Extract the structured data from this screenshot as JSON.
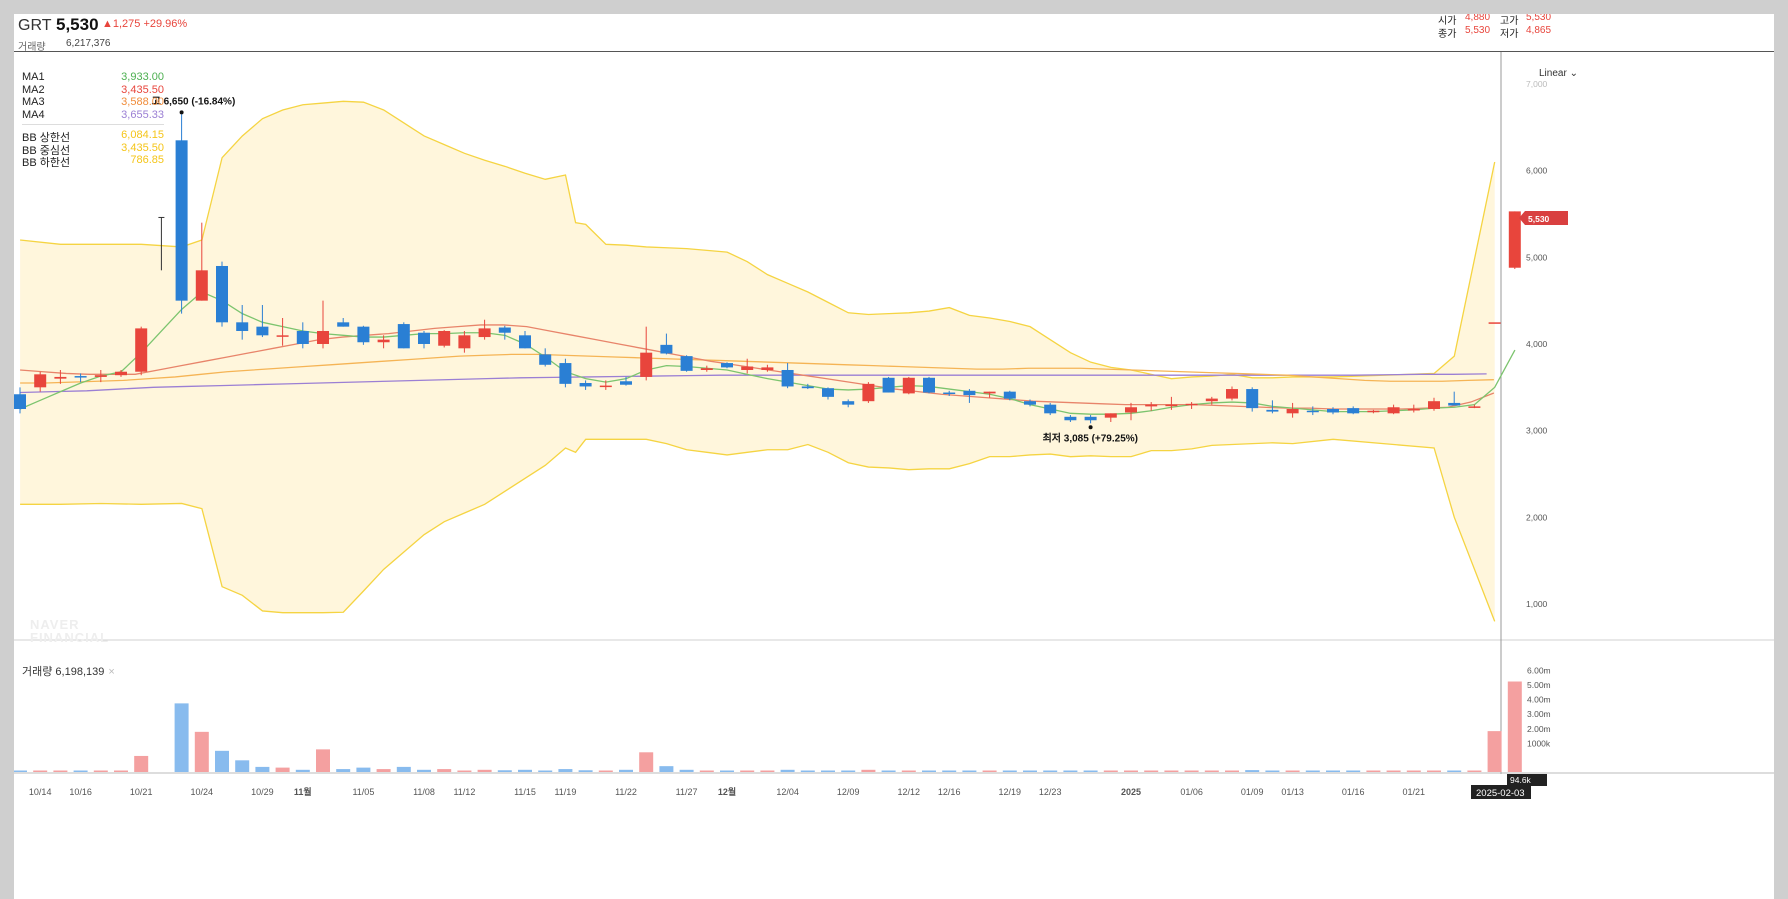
{
  "header": {
    "symbol": "GRT",
    "price": "5,530",
    "change": "▲1,275 +29.96%",
    "volume_label": "거래량",
    "volume_value": "6,217,376",
    "open_label": "시가",
    "open_value": "4,880",
    "high_label": "고가",
    "high_value": "5,530",
    "close_label": "종가",
    "close_value": "5,530",
    "low_label": "저가",
    "low_value": "4,865"
  },
  "legend": [
    {
      "name": "MA1",
      "value": "3,933.00",
      "color": "#4caf50"
    },
    {
      "name": "MA2",
      "value": "3,435.50",
      "color": "#e8453c"
    },
    {
      "name": "MA3",
      "value": "3,588.00",
      "color": "#f08c3a"
    },
    {
      "name": "MA4",
      "value": "3,655.33",
      "color": "#9b7fd4"
    },
    {
      "name": "BB 상한선",
      "value": "6,084.15",
      "color": "#f5c518"
    },
    {
      "name": "BB 중심선",
      "value": "3,435.50",
      "color": "#f5c518"
    },
    {
      "name": "BB 하한선",
      "value": "786.85",
      "color": "#f5c518"
    }
  ],
  "scale_mode": "Linear",
  "watermark": [
    "NAVER",
    "FINANCIAL"
  ],
  "volume_title": "거래량 6,198,139",
  "volume_close_glyph": "×",
  "price_tag": "5,530",
  "volume_tag": "94.6k",
  "date_tag": "2025-02-03",
  "high_annotation": "고 6,650 (-16.84%)",
  "low_annotation": "최저 3,085 (+79.25%)",
  "colors": {
    "up": "#e8453c",
    "down": "#2a7fd4",
    "up_vol": "#f4a0a0",
    "down_vol": "#88bbee",
    "band_fill": "#fff6dc",
    "band_line": "#f5d442"
  },
  "chart_data": {
    "type": "candlestick",
    "price_axis": {
      "min": 0,
      "max": 7000,
      "ticks": [
        "1,000",
        "2,000",
        "3,000",
        "4,000",
        "5,000",
        "6,000",
        "7,000"
      ],
      "tick_values": [
        1000,
        2000,
        3000,
        4000,
        5000,
        6000,
        7000
      ]
    },
    "volume_axis": {
      "min": 0,
      "max": 7000000,
      "ticks": [
        "1000k",
        "2.00m",
        "3.00m",
        "4.00m",
        "5.00m",
        "6.00m"
      ],
      "tick_values": [
        1000000,
        2000000,
        3000000,
        4000000,
        5000000,
        6000000
      ]
    },
    "x_ticks": [
      {
        "label": "10/14",
        "i": 1
      },
      {
        "label": "10/16",
        "i": 3
      },
      {
        "label": "10/21",
        "i": 6
      },
      {
        "label": "10/24",
        "i": 9
      },
      {
        "label": "10/29",
        "i": 12
      },
      {
        "label": "11월",
        "i": 14,
        "bold": true
      },
      {
        "label": "11/05",
        "i": 17
      },
      {
        "label": "11/08",
        "i": 20
      },
      {
        "label": "11/12",
        "i": 22
      },
      {
        "label": "11/15",
        "i": 25
      },
      {
        "label": "11/19",
        "i": 27
      },
      {
        "label": "11/22",
        "i": 30
      },
      {
        "label": "11/27",
        "i": 33
      },
      {
        "label": "12월",
        "i": 35,
        "bold": true
      },
      {
        "label": "12/04",
        "i": 38
      },
      {
        "label": "12/09",
        "i": 41
      },
      {
        "label": "12/12",
        "i": 44
      },
      {
        "label": "12/16",
        "i": 46
      },
      {
        "label": "12/19",
        "i": 49
      },
      {
        "label": "12/23",
        "i": 51
      },
      {
        "label": "2025",
        "i": 55,
        "bold": true
      },
      {
        "label": "01/06",
        "i": 58
      },
      {
        "label": "01/09",
        "i": 61
      },
      {
        "label": "01/13",
        "i": 63
      },
      {
        "label": "01/16",
        "i": 66
      },
      {
        "label": "01/21",
        "i": 69
      }
    ],
    "candles": [
      {
        "o": 3420,
        "h": 3500,
        "l": 3200,
        "c": 3250,
        "v": 60000
      },
      {
        "o": 3500,
        "h": 3680,
        "l": 3450,
        "c": 3650,
        "v": 40000
      },
      {
        "o": 3600,
        "h": 3700,
        "l": 3540,
        "c": 3620,
        "v": 35000
      },
      {
        "o": 3630,
        "h": 3660,
        "l": 3560,
        "c": 3620,
        "v": 30000
      },
      {
        "o": 3620,
        "h": 3700,
        "l": 3560,
        "c": 3640,
        "v": 45000
      },
      {
        "o": 3640,
        "h": 3700,
        "l": 3620,
        "c": 3680,
        "v": 50000
      },
      {
        "o": 3680,
        "h": 4200,
        "l": 3640,
        "c": 4180,
        "v": 1100000
      },
      {
        "o": 5450,
        "h": 5460,
        "l": 4850,
        "c": 5450,
        "v": 0
      },
      {
        "o": 6350,
        "h": 6650,
        "l": 4350,
        "c": 4500,
        "v": 4700000
      },
      {
        "o": 4500,
        "h": 5400,
        "l": 4500,
        "c": 4850,
        "v": 2750000
      },
      {
        "o": 4900,
        "h": 4950,
        "l": 4200,
        "c": 4250,
        "v": 1450000
      },
      {
        "o": 4250,
        "h": 4450,
        "l": 4050,
        "c": 4150,
        "v": 800000
      },
      {
        "o": 4200,
        "h": 4450,
        "l": 4080,
        "c": 4100,
        "v": 350000
      },
      {
        "o": 4100,
        "h": 4300,
        "l": 3980,
        "c": 4100,
        "v": 300000
      },
      {
        "o": 4150,
        "h": 4250,
        "l": 3950,
        "c": 4000,
        "v": 150000
      },
      {
        "o": 4000,
        "h": 4500,
        "l": 3950,
        "c": 4150,
        "v": 1550000
      },
      {
        "o": 4250,
        "h": 4300,
        "l": 4200,
        "c": 4200,
        "v": 200000
      },
      {
        "o": 4200,
        "h": 4210,
        "l": 3990,
        "c": 4020,
        "v": 300000
      },
      {
        "o": 4020,
        "h": 4100,
        "l": 3950,
        "c": 4050,
        "v": 200000
      },
      {
        "o": 4230,
        "h": 4250,
        "l": 3950,
        "c": 3950,
        "v": 350000
      },
      {
        "o": 4130,
        "h": 4150,
        "l": 3950,
        "c": 4000,
        "v": 150000
      },
      {
        "o": 3980,
        "h": 4160,
        "l": 3960,
        "c": 4150,
        "v": 200000
      },
      {
        "o": 3950,
        "h": 4150,
        "l": 3900,
        "c": 4100,
        "v": 100000
      },
      {
        "o": 4080,
        "h": 4280,
        "l": 4050,
        "c": 4180,
        "v": 150000
      },
      {
        "o": 4190,
        "h": 4210,
        "l": 4050,
        "c": 4130,
        "v": 120000
      },
      {
        "o": 4100,
        "h": 4150,
        "l": 3950,
        "c": 3950,
        "v": 150000
      },
      {
        "o": 3880,
        "h": 3950,
        "l": 3740,
        "c": 3760,
        "v": 80000
      },
      {
        "o": 3780,
        "h": 3830,
        "l": 3500,
        "c": 3540,
        "v": 200000
      },
      {
        "o": 3550,
        "h": 3580,
        "l": 3470,
        "c": 3510,
        "v": 120000
      },
      {
        "o": 3510,
        "h": 3580,
        "l": 3470,
        "c": 3520,
        "v": 100000
      },
      {
        "o": 3570,
        "h": 3620,
        "l": 3520,
        "c": 3530,
        "v": 150000
      },
      {
        "o": 3620,
        "h": 4200,
        "l": 3580,
        "c": 3900,
        "v": 1350000
      },
      {
        "o": 3990,
        "h": 4120,
        "l": 3880,
        "c": 3890,
        "v": 400000
      },
      {
        "o": 3860,
        "h": 3870,
        "l": 3680,
        "c": 3690,
        "v": 150000
      },
      {
        "o": 3700,
        "h": 3750,
        "l": 3680,
        "c": 3720,
        "v": 100000
      },
      {
        "o": 3780,
        "h": 3790,
        "l": 3720,
        "c": 3730,
        "v": 80000
      },
      {
        "o": 3700,
        "h": 3830,
        "l": 3660,
        "c": 3740,
        "v": 60000
      },
      {
        "o": 3700,
        "h": 3760,
        "l": 3680,
        "c": 3730,
        "v": 60000
      },
      {
        "o": 3700,
        "h": 3780,
        "l": 3490,
        "c": 3510,
        "v": 150000
      },
      {
        "o": 3510,
        "h": 3540,
        "l": 3480,
        "c": 3490,
        "v": 80000
      },
      {
        "o": 3490,
        "h": 3500,
        "l": 3360,
        "c": 3390,
        "v": 90000
      },
      {
        "o": 3340,
        "h": 3360,
        "l": 3270,
        "c": 3300,
        "v": 100000
      },
      {
        "o": 3340,
        "h": 3560,
        "l": 3320,
        "c": 3540,
        "v": 150000
      },
      {
        "o": 3610,
        "h": 3620,
        "l": 3440,
        "c": 3440,
        "v": 100000
      },
      {
        "o": 3430,
        "h": 3620,
        "l": 3420,
        "c": 3610,
        "v": 100000
      },
      {
        "o": 3610,
        "h": 3620,
        "l": 3430,
        "c": 3440,
        "v": 60000
      },
      {
        "o": 3440,
        "h": 3460,
        "l": 3400,
        "c": 3430,
        "v": 50000
      },
      {
        "o": 3460,
        "h": 3480,
        "l": 3320,
        "c": 3410,
        "v": 50000
      },
      {
        "o": 3430,
        "h": 3450,
        "l": 3380,
        "c": 3450,
        "v": 40000
      },
      {
        "o": 3450,
        "h": 3460,
        "l": 3350,
        "c": 3370,
        "v": 40000
      },
      {
        "o": 3340,
        "h": 3360,
        "l": 3280,
        "c": 3300,
        "v": 30000
      },
      {
        "o": 3300,
        "h": 3320,
        "l": 3180,
        "c": 3200,
        "v": 40000
      },
      {
        "o": 3160,
        "h": 3180,
        "l": 3100,
        "c": 3120,
        "v": 30000
      },
      {
        "o": 3160,
        "h": 3180,
        "l": 3085,
        "c": 3120,
        "v": 60000
      },
      {
        "o": 3150,
        "h": 3200,
        "l": 3100,
        "c": 3200,
        "v": 50000
      },
      {
        "o": 3210,
        "h": 3320,
        "l": 3120,
        "c": 3270,
        "v": 70000
      },
      {
        "o": 3280,
        "h": 3330,
        "l": 3230,
        "c": 3300,
        "v": 50000
      },
      {
        "o": 3300,
        "h": 3390,
        "l": 3240,
        "c": 3300,
        "v": 40000
      },
      {
        "o": 3300,
        "h": 3330,
        "l": 3250,
        "c": 3310,
        "v": 40000
      },
      {
        "o": 3340,
        "h": 3390,
        "l": 3300,
        "c": 3370,
        "v": 50000
      },
      {
        "o": 3370,
        "h": 3510,
        "l": 3350,
        "c": 3480,
        "v": 60000
      },
      {
        "o": 3480,
        "h": 3500,
        "l": 3220,
        "c": 3260,
        "v": 130000
      },
      {
        "o": 3240,
        "h": 3350,
        "l": 3200,
        "c": 3220,
        "v": 60000
      },
      {
        "o": 3200,
        "h": 3320,
        "l": 3150,
        "c": 3250,
        "v": 40000
      },
      {
        "o": 3230,
        "h": 3280,
        "l": 3180,
        "c": 3220,
        "v": 60000
      },
      {
        "o": 3250,
        "h": 3270,
        "l": 3190,
        "c": 3210,
        "v": 50000
      },
      {
        "o": 3260,
        "h": 3280,
        "l": 3190,
        "c": 3200,
        "v": 40000
      },
      {
        "o": 3220,
        "h": 3240,
        "l": 3200,
        "c": 3230,
        "v": 30000
      },
      {
        "o": 3200,
        "h": 3300,
        "l": 3190,
        "c": 3270,
        "v": 60000
      },
      {
        "o": 3240,
        "h": 3300,
        "l": 3210,
        "c": 3250,
        "v": 40000
      },
      {
        "o": 3250,
        "h": 3380,
        "l": 3230,
        "c": 3340,
        "v": 100000
      },
      {
        "o": 3320,
        "h": 3450,
        "l": 3290,
        "c": 3290,
        "v": 40000
      },
      {
        "o": 3280,
        "h": 3300,
        "l": 3260,
        "c": 3280,
        "v": 30000
      },
      {
        "o": 4250,
        "h": 4250,
        "l": 4250,
        "c": 4250,
        "v": 2800000
      },
      {
        "o": 4880,
        "h": 5530,
        "l": 4865,
        "c": 5530,
        "v": 6198139
      }
    ],
    "bb_upper": [
      5200,
      5150,
      5150,
      5150,
      5120,
      5200,
      6150,
      6400,
      6600,
      6700,
      6760,
      6780,
      6800,
      6790,
      6700,
      6550,
      6400,
      6300,
      6200,
      6120,
      6050,
      5970,
      5900,
      5950,
      5400,
      5380,
      5150,
      5140,
      5120,
      5110,
      5100,
      5080,
      5060,
      4950,
      4800,
      4700,
      4600,
      4480,
      4360,
      4340,
      4350,
      4360,
      4380,
      4420,
      4330,
      4300,
      4260,
      4200,
      4050,
      3900,
      3790,
      3730,
      3700,
      3650,
      3600,
      3620,
      3630,
      3650,
      3610,
      3610,
      3620,
      3620,
      3660,
      3860,
      6100
    ],
    "bb_lower": [
      2150,
      2150,
      2160,
      2150,
      2160,
      2100,
      1200,
      1100,
      920,
      900,
      900,
      900,
      905,
      1150,
      1400,
      1600,
      1800,
      1950,
      2050,
      2150,
      2300,
      2450,
      2600,
      2800,
      2750,
      2900,
      2900,
      2900,
      2900,
      2850,
      2780,
      2750,
      2720,
      2750,
      2780,
      2780,
      2840,
      2750,
      2630,
      2580,
      2570,
      2550,
      2560,
      2560,
      2620,
      2700,
      2700,
      2720,
      2730,
      2700,
      2710,
      2700,
      2700,
      2770,
      2770,
      2790,
      2830,
      2840,
      2850,
      2860,
      2850,
      2900,
      2800,
      2000,
      800
    ],
    "bb_x": [
      0,
      2,
      4,
      6,
      8,
      9,
      10,
      11,
      12,
      13,
      14,
      15,
      16,
      17,
      18,
      19,
      20,
      21,
      22,
      23,
      24,
      25,
      26,
      27,
      27.5,
      28,
      29,
      30,
      31,
      32,
      33,
      34,
      35,
      36,
      37,
      38,
      39,
      40,
      41,
      42,
      43,
      44,
      45,
      46,
      47,
      48,
      49,
      50,
      51,
      52,
      53,
      54,
      55,
      56,
      57,
      58,
      59,
      60,
      61,
      62,
      63,
      65,
      70,
      71,
      73
    ],
    "ma1": [
      3250,
      3350,
      3450,
      3550,
      3630,
      3680,
      3900,
      4150,
      4400,
      4600,
      4500,
      4350,
      4250,
      4200,
      4150,
      4120,
      4100,
      4080,
      4080,
      4100,
      4120,
      4120,
      4130,
      4130,
      4100,
      4000,
      3850,
      3680,
      3600,
      3560,
      3600,
      3700,
      3750,
      3740,
      3720,
      3700,
      3650,
      3600,
      3560,
      3520,
      3480,
      3470,
      3480,
      3500,
      3520,
      3510,
      3480,
      3450,
      3420,
      3370,
      3300,
      3250,
      3200,
      3190,
      3190,
      3200,
      3230,
      3270,
      3300,
      3320,
      3330,
      3320,
      3280,
      3260,
      3240,
      3220,
      3220,
      3220,
      3230,
      3240,
      3260,
      3270,
      3300,
      3500,
      3930
    ],
    "ma2": [
      3700,
      3680,
      3660,
      3650,
      3650,
      3650,
      3700,
      3750,
      3800,
      3850,
      3900,
      3950,
      4000,
      4050,
      4080,
      4100,
      4120,
      4150,
      4180,
      4200,
      4220,
      4220,
      4200,
      4150,
      4100,
      4050,
      4000,
      3950,
      3900,
      3850,
      3800,
      3760,
      3720,
      3680,
      3640,
      3600,
      3560,
      3520,
      3480,
      3450,
      3420,
      3400,
      3380,
      3360,
      3340,
      3330,
      3320,
      3310,
      3300,
      3300,
      3300,
      3300,
      3290,
      3280,
      3270,
      3260,
      3260,
      3250,
      3250,
      3250,
      3250,
      3260,
      3270,
      3330,
      3435
    ],
    "ma3": [
      3550,
      3550,
      3560,
      3570,
      3580,
      3600,
      3620,
      3650,
      3680,
      3700,
      3720,
      3740,
      3760,
      3780,
      3800,
      3820,
      3840,
      3860,
      3870,
      3880,
      3880,
      3870,
      3860,
      3850,
      3840,
      3830,
      3820,
      3810,
      3800,
      3790,
      3780,
      3770,
      3760,
      3750,
      3740,
      3730,
      3720,
      3710,
      3710,
      3720,
      3720,
      3720,
      3710,
      3700,
      3690,
      3680,
      3670,
      3660,
      3650,
      3640,
      3620,
      3600,
      3580,
      3570,
      3570,
      3570,
      3580,
      3588
    ],
    "ma4": [
      3440,
      3450,
      3460,
      3480,
      3500,
      3510,
      3520,
      3530,
      3540,
      3550,
      3560,
      3570,
      3580,
      3590,
      3600,
      3610,
      3615,
      3620,
      3625,
      3630,
      3635,
      3640,
      3640,
      3640,
      3640,
      3640,
      3640,
      3640,
      3640,
      3640,
      3640,
      3640,
      3640,
      3640,
      3640,
      3640,
      3640,
      3640,
      3640,
      3640,
      3640,
      3645,
      3650,
      3650,
      3655
    ]
  }
}
